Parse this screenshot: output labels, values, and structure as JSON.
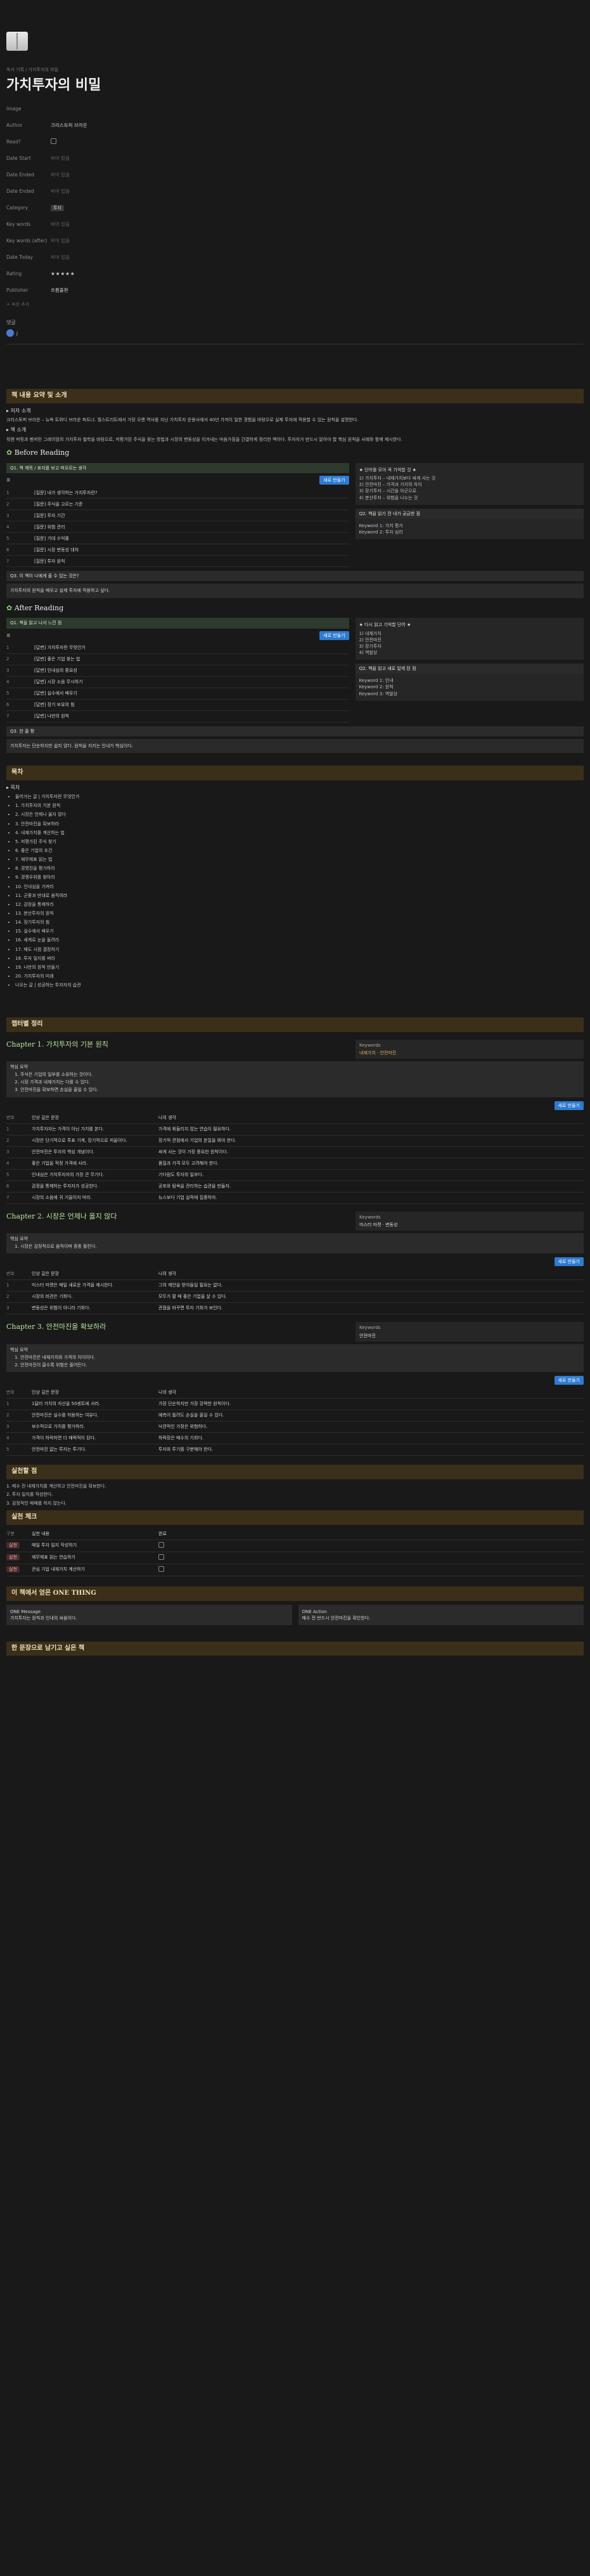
{
  "breadcrumb": "독서 기록 / 가지투자의 비밀",
  "title": "가치투자의 비밀",
  "props": [
    {
      "k": "Image",
      "v": ""
    },
    {
      "k": "Author",
      "v": "크리스토퍼 브라운"
    },
    {
      "k": "Read?",
      "v": ""
    },
    {
      "k": "Date Start",
      "v": "비어 있음"
    },
    {
      "k": "Date Ended",
      "v": "비어 있음"
    },
    {
      "k": "Date Ended",
      "v": "비어 있음"
    },
    {
      "k": "Category",
      "v": "투자"
    },
    {
      "k": "Key words",
      "v": "비어 있음"
    },
    {
      "k": "Key words (after)",
      "v": "비어 있음"
    },
    {
      "k": "Date Today",
      "v": "비어 있음"
    },
    {
      "k": "Rating",
      "v": "★★★★★"
    },
    {
      "k": "Publisher",
      "v": "흐름출판"
    }
  ],
  "add_prop": "+ 속성 추가",
  "comments_h": "댓글",
  "comment_user": "J",
  "section1": "책 내용 요약 및 소개",
  "book_intro_t": "▸ 저자 소개",
  "book_intro": "크리스토퍼 브라운 – 뉴욕 트위디 브라운 파트너. 월스트리트에서 가장 오랜 역사를 지닌 가치투자 운용사에서 40년 가까이 일한 경험을 바탕으로 실제 투자에 적용할 수 있는 원칙을 설명한다.",
  "book_summary_t": "▸ 책 소개",
  "book_summary": "워렌 버핏과 벤저민 그레이엄의 가치투자 철학을 바탕으로, 저평가된 주식을 찾는 방법과 시장의 변동성을 이겨내는 마음가짐을 간결하게 정리한 책이다. 투자자가 반드시 알아야 할 핵심 원칙을 사례와 함께 제시한다.",
  "before_h": "Before Reading",
  "before_bar": "Q1. 책 제목 / 표지를 보고 떠오르는 생각",
  "before_table_title": "표",
  "before_new": "새로 만들기",
  "before_rows": [
    {
      "no": "1",
      "t": "[질문] 내가 생각하는 가치투자란?",
      "v": ""
    },
    {
      "no": "2",
      "t": "[질문] 주식을 고르는 기준",
      "v": ""
    },
    {
      "no": "3",
      "t": "[질문] 투자 기간",
      "v": ""
    },
    {
      "no": "4",
      "t": "[질문] 위험 관리",
      "v": ""
    },
    {
      "no": "5",
      "t": "[질문] 기대 수익률",
      "v": ""
    },
    {
      "no": "6",
      "t": "[질문] 시장 변동성 대처",
      "v": ""
    },
    {
      "no": "7",
      "t": "[질문] 투자 원칙",
      "v": ""
    }
  ],
  "before_side_t": "★ 단어를 모아 꼭 기억할 것 ★",
  "before_side": [
    "1) 가치투자 – 내재가치보다 싸게 사는 것",
    "2) 안전마진 – 가격과 가치의 차이",
    "3) 장기투자 – 시간을 아군으로",
    "4) 분산투자 – 위험을 나누는 것"
  ],
  "before_box_t": "Q2. 책을 읽기 전 내가 궁금한 점",
  "before_box": [
    "Keyword 1: 가치 평가",
    "Keyword 2: 투자 심리"
  ],
  "before_q3": "Q3. 이 책이 나에게 줄 수 있는 것은?",
  "before_q3_a": "가치투자의 원칙을 배우고 실제 투자에 적용하고 싶다.",
  "after_h": "After Reading",
  "after_bar": "Q1. 책을 읽고 나서 느낀 점",
  "after_rows": [
    {
      "no": "1",
      "t": "[답변] 가치투자란 무엇인가",
      "v": ""
    },
    {
      "no": "2",
      "t": "[답변] 좋은 기업 찾는 법",
      "v": ""
    },
    {
      "no": "3",
      "t": "[답변] 인내심의 중요성",
      "v": ""
    },
    {
      "no": "4",
      "t": "[답변] 시장 소음 무시하기",
      "v": ""
    },
    {
      "no": "5",
      "t": "[답변] 실수에서 배우기",
      "v": ""
    },
    {
      "no": "6",
      "t": "[답변] 장기 보유의 힘",
      "v": ""
    },
    {
      "no": "7",
      "t": "[답변] 나만의 원칙",
      "v": ""
    }
  ],
  "after_side_t": "★ 다시 읽고 기억할 단어 ★",
  "after_side": [
    "1) 내재가치",
    "2) 안전마진",
    "3) 장기투자",
    "4) 역발상"
  ],
  "after_box_t": "Q2. 책을 읽고 새로 알게 된 점",
  "after_box": [
    "Keyword 1: 인내",
    "Keyword 2: 원칙",
    "Keyword 3: 역발상"
  ],
  "after_q3": "Q3. 한 줄 평",
  "after_q3_a": "가치투자는 단순하지만 쉽지 않다. 원칙을 지키는 인내가 핵심이다.",
  "toc_h": "목차",
  "toc_t": "▸ 목차",
  "toc": [
    "들어가는 글 | 가치투자란 무엇인가",
    "1. 가치투자의 기본 원칙",
    "2. 시장은 언제나 옳지 않다",
    "3. 안전마진을 확보하라",
    "4. 내재가치를 계산하는 법",
    "5. 저평가된 주식 찾기",
    "6. 좋은 기업의 조건",
    "7. 재무제표 읽는 법",
    "8. 경영진을 평가하라",
    "9. 경쟁우위를 찾아라",
    "10. 인내심을 가져라",
    "11. 군중과 반대로 움직여라",
    "12. 감정을 통제하라",
    "13. 분산투자의 원칙",
    "14. 장기투자의 힘",
    "15. 실수에서 배우기",
    "16. 세계로 눈을 돌려라",
    "17. 매도 시점 결정하기",
    "18. 투자 일지를 써라",
    "19. 나만의 원칙 만들기",
    "20. 가치투자의 미래",
    "나오는 글 | 성공하는 투자자의 습관"
  ],
  "note_h": "챕터별 정리",
  "ch1_title": "Chapter 1. 가치투자의 기본 원칙",
  "ch1_kw_t": "Keywords",
  "ch1_kw": "내재가치 · 안전마진",
  "ch1_kp_t": "핵심 요약",
  "ch1_kp": [
    "주식은 기업의 일부를 소유하는 것이다.",
    "시장 가격과 내재가치는 다를 수 있다.",
    "안전마진을 확보하면 손실을 줄일 수 있다."
  ],
  "ch1_new": "새로 만들기",
  "ch1_cols": [
    "번호",
    "인상 깊은 문장",
    "나의 생각"
  ],
  "ch1_rows": [
    {
      "a": "1",
      "b": "가치투자자는 가격이 아닌 가치를 본다.",
      "c": "가격에 휘둘리지 않는 연습이 필요하다."
    },
    {
      "a": "2",
      "b": "시장은 단기적으로 투표 기계, 장기적으로 저울이다.",
      "c": "장기적 관점에서 기업의 본질을 봐야 한다."
    },
    {
      "a": "3",
      "b": "안전마진은 투자의 핵심 개념이다.",
      "c": "싸게 사는 것이 가장 중요한 원칙이다."
    },
    {
      "a": "4",
      "b": "좋은 기업을 적정 가격에 사라.",
      "c": "품질과 가격 모두 고려해야 한다."
    },
    {
      "a": "5",
      "b": "인내심은 가치투자자의 가장 큰 무기다.",
      "c": "기다림도 투자의 일부다."
    },
    {
      "a": "6",
      "b": "감정을 통제하는 투자자가 성공한다.",
      "c": "공포와 탐욕을 관리하는 습관을 만들자."
    },
    {
      "a": "7",
      "b": "시장의 소음에 귀 기울이지 마라.",
      "c": "뉴스보다 기업 실적에 집중하자."
    }
  ],
  "ch2_title": "Chapter 2. 시장은 언제나 옳지 않다",
  "ch2_kw": "미스터 마켓 · 변동성",
  "ch2_kp": [
    "시장은 감정적으로 움직이며 종종 틀린다."
  ],
  "ch2_rows": [
    {
      "a": "1",
      "b": "미스터 마켓은 매일 새로운 가격을 제시한다.",
      "c": "그의 제안을 받아들일 필요는 없다."
    },
    {
      "a": "2",
      "b": "시장의 비관은 기회다.",
      "c": "모두가 팔 때 좋은 기업을 살 수 있다."
    },
    {
      "a": "3",
      "b": "변동성은 위험이 아니라 기회다.",
      "c": "관점을 바꾸면 투자 기회가 보인다."
    }
  ],
  "ch3_title": "Chapter 3. 안전마진을 확보하라",
  "ch3_kw": "안전마진",
  "ch3_kp": [
    "안전마진은 내재가치와 가격의 차이이다.",
    "안전마진이 클수록 위험은 줄어든다."
  ],
  "ch3_rows": [
    {
      "a": "1",
      "b": "1달러 가치의 자산을 50센트에 사라.",
      "c": "가장 단순하지만 가장 강력한 원칙이다."
    },
    {
      "a": "2",
      "b": "안전마진은 실수를 허용하는 여유다.",
      "c": "예측이 틀려도 손실을 줄일 수 있다."
    },
    {
      "a": "3",
      "b": "보수적으로 가치를 평가하라.",
      "c": "낙관적인 가정은 위험하다."
    },
    {
      "a": "4",
      "b": "가격이 하락하면 더 매력적이 된다.",
      "c": "하락장은 매수의 기회다."
    },
    {
      "a": "5",
      "b": "안전마진 없는 투자는 투기다.",
      "c": "투자와 투기를 구분해야 한다."
    }
  ],
  "act_h": "실천할 점",
  "act": [
    "1. 매수 전 내재가치를 계산하고 안전마진을 확보한다.",
    "2. 투자 일지를 작성한다.",
    "3. 감정적인 매매를 하지 않는다."
  ],
  "todo_h": "실천 체크",
  "todo_cols": [
    "구분",
    "실천 내용",
    "완료"
  ],
  "todo_rows": [
    {
      "tag": "실천",
      "t": "매일 투자 일지 작성하기"
    },
    {
      "tag": "실천",
      "t": "재무제표 읽는 연습하기"
    },
    {
      "tag": "실천",
      "t": "관심 기업 내재가치 계산하기"
    }
  ],
  "one_h": "이 책에서 얻은 ONE THING",
  "one_l_t": "ONE Message",
  "one_l": "가치투자는 원칙과 인내의 싸움이다.",
  "one_r_t": "ONE Action",
  "one_r": "매수 전 반드시 안전마진을 확인한다.",
  "last_h": "한 문장으로 남기고 싶은 책"
}
